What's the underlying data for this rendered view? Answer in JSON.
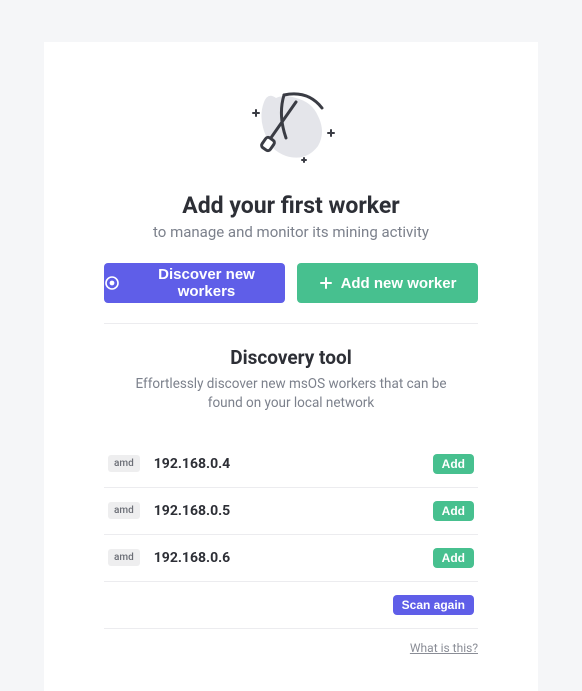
{
  "hero": {
    "title": "Add your first worker",
    "subtitle": "to manage and monitor its mining activity"
  },
  "buttons": {
    "discover": "Discover new workers",
    "add": "Add new worker"
  },
  "discovery": {
    "title": "Discovery tool",
    "subtitle": "Effortlessly discover new msOS workers that can be found on your local network",
    "rows": [
      {
        "badge": "amd",
        "ip": "192.168.0.4",
        "action": "Add"
      },
      {
        "badge": "amd",
        "ip": "192.168.0.5",
        "action": "Add"
      },
      {
        "badge": "amd",
        "ip": "192.168.0.6",
        "action": "Add"
      }
    ],
    "scan": "Scan again",
    "help": "What is this?"
  }
}
